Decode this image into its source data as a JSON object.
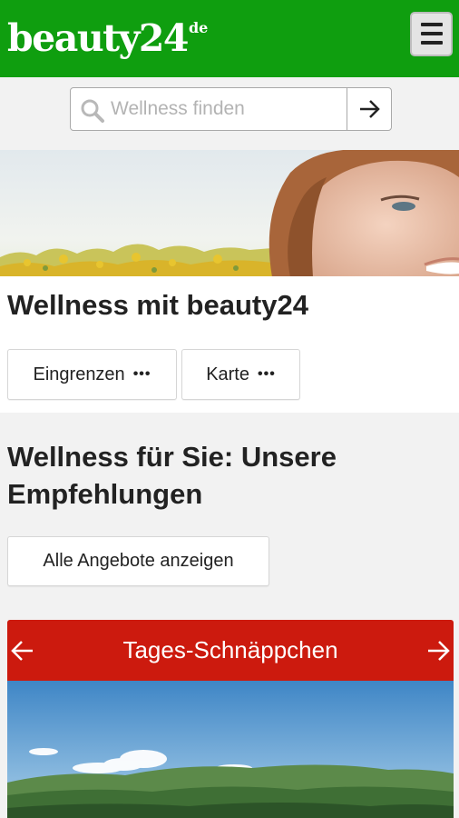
{
  "header": {
    "logo_text": "beauty24",
    "logo_tld": "de",
    "brand_color": "#0f9e0f",
    "menu_icon": "hamburger-menu-icon"
  },
  "search": {
    "placeholder": "Wellness finden",
    "value": "",
    "search_icon": "magnifier-icon",
    "submit_icon": "arrow-right-icon"
  },
  "hero": {
    "title": "Wellness mit beauty24"
  },
  "filters": {
    "refine_label": "Eingrenzen",
    "map_label": "Karte",
    "more_icon": "more-dots-icon"
  },
  "recommendations": {
    "title": "Wellness für Sie: Unsere Empfehlungen",
    "all_offers_label": "Alle Angebote anzeigen"
  },
  "deal": {
    "title": "Tages-Schnäppchen",
    "accent_color": "#cc1a0e",
    "prev_icon": "arrow-left-icon",
    "next_icon": "arrow-right-icon"
  }
}
